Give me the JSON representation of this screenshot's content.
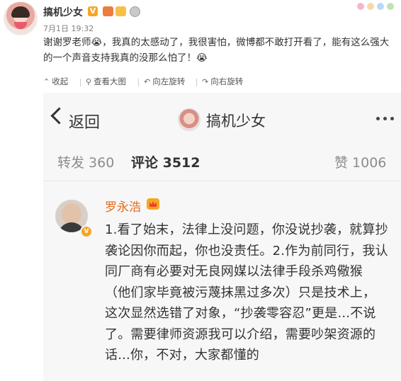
{
  "post": {
    "username": "搞机少女",
    "verified_mark": "V",
    "timestamp": "7月1日 19:32",
    "text": "谢谢罗老师😭，我真的太感动了，我很害怕，微博都不敢打开看了，能有这么强大的一个声音支持我真的没那么怕了！😭"
  },
  "toolbar": {
    "collapse_label": "收起",
    "view_large_label": "查看大图",
    "rotate_left_label": "向左旋转",
    "rotate_right_label": "向右旋转"
  },
  "screenshot": {
    "back_label": "返回",
    "title": "搞机少女",
    "tabs": [
      {
        "label": "转发 360",
        "active": false
      },
      {
        "label": "评论 3512",
        "active": true
      },
      {
        "label": "赞 1006",
        "active": false
      }
    ],
    "comment": {
      "author": "罗永浩",
      "verified_mark": "V",
      "text": "1.看了始末，法律上没问题，你没说抄袭，就算抄袭论因你而起，你也没责任。2.作为前同行，我认同厂商有必要对无良网媒以法律手段杀鸡儆猴（他们家毕竟被污蔑抹黑过多次）只是技术上，这次显然选错了对象，“抄袭零容忍”更是...不说了。需要律师资源我可以介绍，需要吵架资源的话...你，不对，大家都懂的"
    }
  },
  "icons": [
    "collapse-icon",
    "search-icon",
    "rotate-left-icon",
    "rotate-right-icon",
    "back-chevron-icon",
    "more-icon",
    "crown-icon",
    "crying-emoji-icon"
  ],
  "colors": {
    "accent_orange": "#e86a1a",
    "verified": "#f5a623",
    "text": "#333333",
    "muted": "#8c8c8c"
  }
}
